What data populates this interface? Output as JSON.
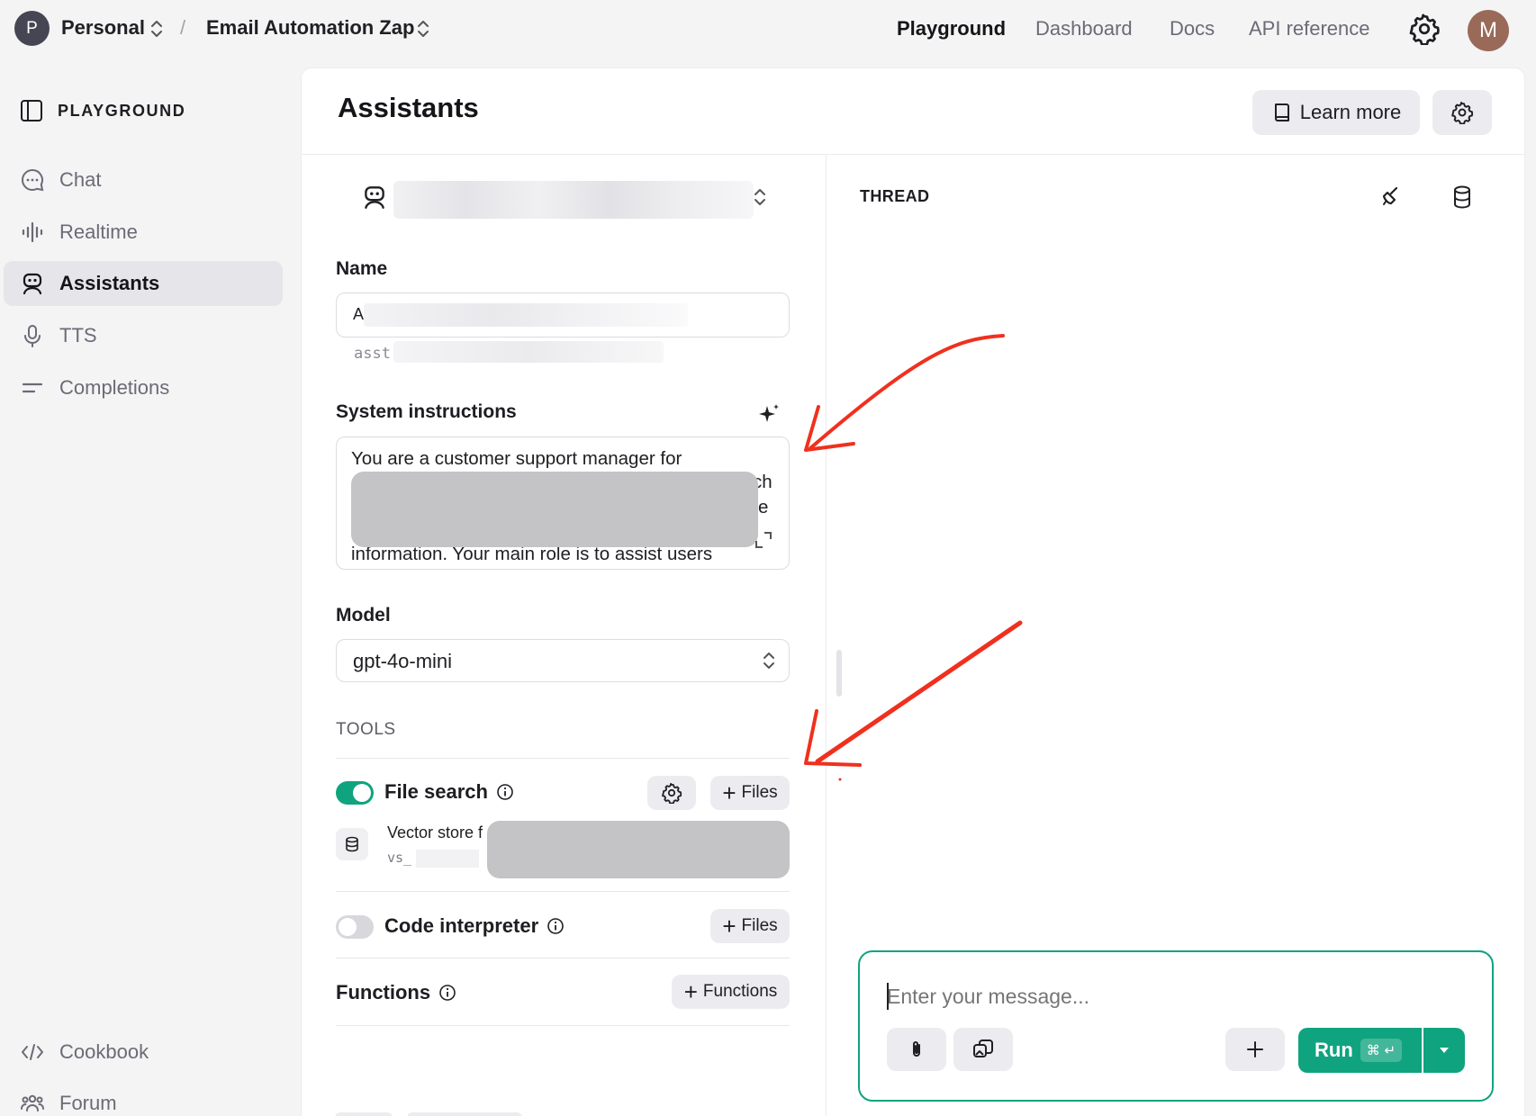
{
  "header": {
    "org_initial": "P",
    "org_name": "Personal",
    "project_name": "Email Automation Zap",
    "separator": "/",
    "nav": [
      "Playground",
      "Dashboard",
      "Docs",
      "API reference"
    ],
    "active_nav": "Playground",
    "user_initial": "M"
  },
  "sidebar": {
    "title": "PLAYGROUND",
    "items": [
      {
        "label": "Chat",
        "icon": "chat-bubble-icon"
      },
      {
        "label": "Realtime",
        "icon": "waveform-icon"
      },
      {
        "label": "Assistants",
        "icon": "robot-icon",
        "active": true
      },
      {
        "label": "TTS",
        "icon": "microphone-icon"
      },
      {
        "label": "Completions",
        "icon": "lines-icon"
      }
    ],
    "footer": [
      {
        "label": "Cookbook",
        "icon": "code-icon"
      },
      {
        "label": "Forum",
        "icon": "people-icon"
      }
    ]
  },
  "main": {
    "title": "Assistants",
    "learn_more": "Learn more",
    "name_label": "Name",
    "name_value": "A",
    "assistant_id_prefix": "asst",
    "instructions_label": "System instructions",
    "instructions_line1": "You are a customer support manager for",
    "instructions_frag1": "ch",
    "instructions_frag2": "e",
    "instructions_last": "information. Your main role is to assist users",
    "model_label": "Model",
    "model_value": "gpt-4o-mini",
    "tools_label": "TOOLS",
    "tools": {
      "file_search": {
        "label": "File search",
        "enabled": true,
        "files_button": "Files"
      },
      "vector_store_name": "Vector store f",
      "vector_store_id": "vs_",
      "code_interpreter": {
        "label": "Code interpreter",
        "enabled": false,
        "files_button": "Files"
      },
      "functions": {
        "label": "Functions",
        "button": "Functions"
      }
    }
  },
  "thread": {
    "label": "THREAD",
    "placeholder": "Enter your message...",
    "run_label": "Run",
    "shortcut": "⌘ ↵"
  },
  "colors": {
    "accent": "#10a37f",
    "annotation": "#f0301e",
    "redaction": "#c4c4c6"
  }
}
